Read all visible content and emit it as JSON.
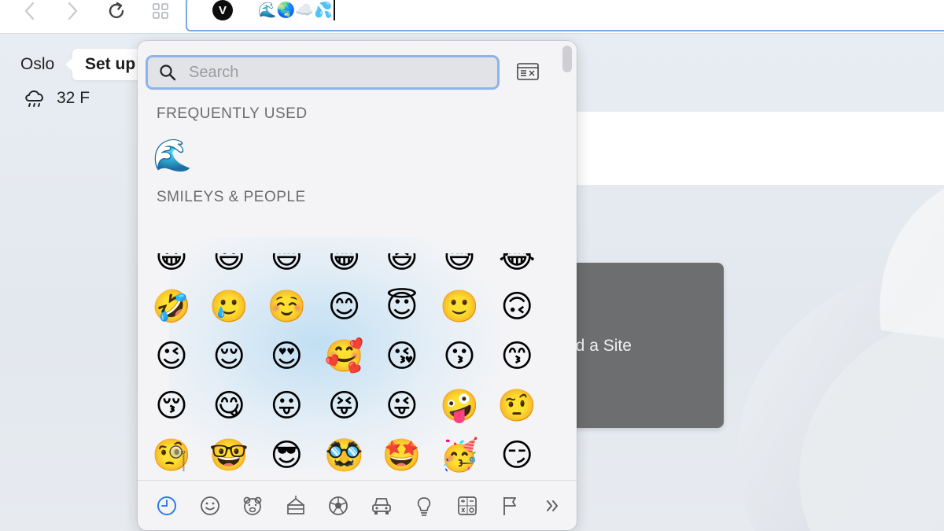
{
  "toolbar": {
    "back_icon": "chevron-left-icon",
    "forward_icon": "chevron-right-icon",
    "reload_icon": "reload-icon",
    "tabs_icon": "grid-icon",
    "address_value": "🌊🌏☁️💦",
    "site_icon_letter": "V"
  },
  "weather": {
    "city": "Oslo",
    "temperature": "32 F",
    "icon": "cloud-rain-icon"
  },
  "setup_tooltip": "Set up",
  "speed_dial": {
    "label": "dd a Site"
  },
  "emoji_picker": {
    "search_placeholder": "Search",
    "sections": {
      "frequent": "FREQUENTLY USED",
      "smileys": "SMILEYS & PEOPLE"
    },
    "frequent_emojis": [
      "🌊"
    ],
    "smiley_rows": [
      [
        "😀",
        "😃",
        "😄",
        "😁",
        "😆",
        "😅",
        "😂"
      ],
      [
        "🤣",
        "🥲",
        "☺️",
        "😊",
        "😇",
        "🙂",
        "🙃"
      ],
      [
        "😉",
        "😌",
        "😍",
        "🥰",
        "😘",
        "😗",
        "😙"
      ],
      [
        "😚",
        "😋",
        "😛",
        "😝",
        "😜",
        "🤪",
        "🤨"
      ],
      [
        "🧐",
        "🤓",
        "😎",
        "🥸",
        "🤩",
        "🥳",
        "😏"
      ],
      [
        "😒",
        "😞",
        "😔",
        "😟",
        "😕",
        "🙁",
        "☹️"
      ]
    ],
    "categories": [
      {
        "name": "Frequently Used",
        "icon": "clock-icon",
        "active": true
      },
      {
        "name": "Smileys & People",
        "icon": "smiley-icon",
        "active": false
      },
      {
        "name": "Animals & Nature",
        "icon": "bear-icon",
        "active": false
      },
      {
        "name": "Food & Drink",
        "icon": "cake-icon",
        "active": false
      },
      {
        "name": "Activity",
        "icon": "soccer-ball-icon",
        "active": false
      },
      {
        "name": "Travel & Places",
        "icon": "car-icon",
        "active": false
      },
      {
        "name": "Objects",
        "icon": "lightbulb-icon",
        "active": false
      },
      {
        "name": "Symbols",
        "icon": "symbols-icon",
        "active": false
      },
      {
        "name": "Flags",
        "icon": "flag-icon",
        "active": false
      },
      {
        "name": "More",
        "icon": "double-chevron-right-icon",
        "active": false
      }
    ],
    "accent_color": "#2f7be5"
  }
}
